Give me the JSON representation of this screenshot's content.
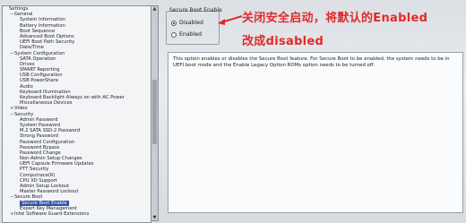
{
  "tree": {
    "items": [
      {
        "label": "Settings",
        "level": 0,
        "node": ""
      },
      {
        "label": "General",
        "level": 1,
        "node": "−"
      },
      {
        "label": "System Information",
        "level": 2,
        "node": ""
      },
      {
        "label": "Battery Information",
        "level": 2,
        "node": ""
      },
      {
        "label": "Boot Sequence",
        "level": 2,
        "node": ""
      },
      {
        "label": "Advanced Boot Options",
        "level": 2,
        "node": ""
      },
      {
        "label": "UEFI Boot Path Security",
        "level": 2,
        "node": ""
      },
      {
        "label": "Date/Time",
        "level": 2,
        "node": ""
      },
      {
        "label": "System Configuration",
        "level": 1,
        "node": "−"
      },
      {
        "label": "SATA Operation",
        "level": 2,
        "node": ""
      },
      {
        "label": "Drives",
        "level": 2,
        "node": ""
      },
      {
        "label": "SMART Reporting",
        "level": 2,
        "node": ""
      },
      {
        "label": "USB Configuration",
        "level": 2,
        "node": ""
      },
      {
        "label": "USB PowerShare",
        "level": 2,
        "node": ""
      },
      {
        "label": "Audio",
        "level": 2,
        "node": ""
      },
      {
        "label": "Keyboard Illumination",
        "level": 2,
        "node": ""
      },
      {
        "label": "Keyboard Backlight Always on with AC Power",
        "level": 2,
        "node": ""
      },
      {
        "label": "Miscellaneous Devices",
        "level": 2,
        "node": ""
      },
      {
        "label": "Video",
        "level": 1,
        "node": "+"
      },
      {
        "label": "Security",
        "level": 1,
        "node": "−"
      },
      {
        "label": "Admin Password",
        "level": 2,
        "node": ""
      },
      {
        "label": "System Password",
        "level": 2,
        "node": ""
      },
      {
        "label": "M.2 SATA SSD-2 Password",
        "level": 2,
        "node": ""
      },
      {
        "label": "Strong Password",
        "level": 2,
        "node": ""
      },
      {
        "label": "Password Configuration",
        "level": 2,
        "node": ""
      },
      {
        "label": "Password Bypass",
        "level": 2,
        "node": ""
      },
      {
        "label": "Password Change",
        "level": 2,
        "node": ""
      },
      {
        "label": "Non-Admin Setup Changes",
        "level": 2,
        "node": ""
      },
      {
        "label": "UEFI Capsule Firmware Updates",
        "level": 2,
        "node": ""
      },
      {
        "label": "PTT Security",
        "level": 2,
        "node": ""
      },
      {
        "label": "Computrace(R)",
        "level": 2,
        "node": ""
      },
      {
        "label": "CPU XD Support",
        "level": 2,
        "node": ""
      },
      {
        "label": "Admin Setup Lockout",
        "level": 2,
        "node": ""
      },
      {
        "label": "Master Password Lockout",
        "level": 2,
        "node": ""
      },
      {
        "label": "Secure Boot",
        "level": 1,
        "node": "−"
      },
      {
        "label": "Secure Boot Enable",
        "level": 2,
        "node": "",
        "selected": true
      },
      {
        "label": "Expert Key Management",
        "level": 2,
        "node": ""
      },
      {
        "label": "Intel Software Guard Extensions",
        "level": 1,
        "node": "+"
      }
    ]
  },
  "group": {
    "title": "Secure Boot Enable",
    "options": [
      {
        "label": "Disabled",
        "checked": true
      },
      {
        "label": "Enabled",
        "checked": false
      }
    ]
  },
  "annotation": {
    "line1": "关闭安全启动，将默认的Enabled",
    "line2": "改成disabled",
    "color": "#e02a2a"
  },
  "description": "This option enables or disables the Secure Boot feature. For Secure Boot to be enabled, the system needs to be in UEFI boot mode and the Enable Legacy Option ROMs option needs to be turned off."
}
